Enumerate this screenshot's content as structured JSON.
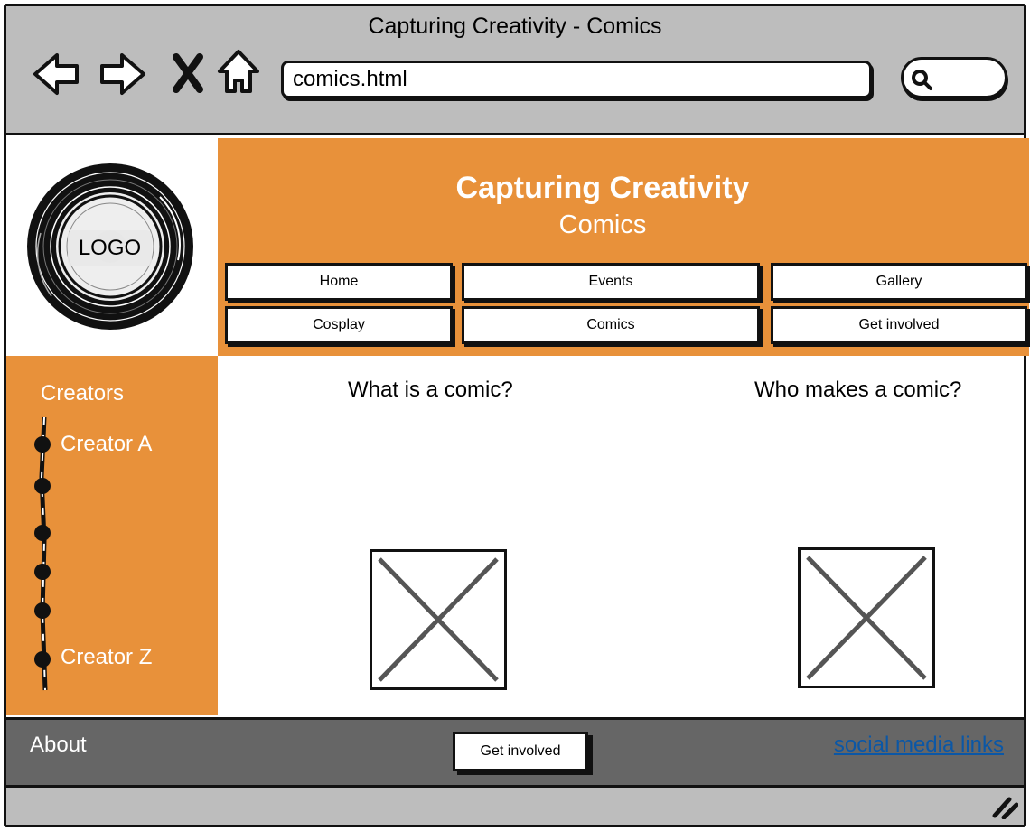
{
  "window": {
    "title": "Capturing Creativity - Comics"
  },
  "toolbar": {
    "back_icon": "back-arrow-icon",
    "forward_icon": "forward-arrow-icon",
    "stop_icon": "close-icon",
    "home_icon": "home-icon",
    "url": "comics.html",
    "search_icon": "search-icon"
  },
  "logo": {
    "label": "LOGO"
  },
  "header": {
    "title": "Capturing Creativity",
    "subtitle": "Comics"
  },
  "nav": {
    "items": [
      {
        "label": "Home"
      },
      {
        "label": "Events"
      },
      {
        "label": "Gallery"
      },
      {
        "label": "Cosplay"
      },
      {
        "label": "Comics"
      },
      {
        "label": "Get involved"
      }
    ]
  },
  "sidebar": {
    "title": "Creators",
    "first_creator": "Creator A",
    "last_creator": "Creator Z"
  },
  "main": {
    "left_heading": "What is a comic?",
    "right_heading": "Who makes a comic?"
  },
  "footer": {
    "about": "About",
    "button": "Get involved",
    "social": "social media links"
  },
  "colors": {
    "accent": "#e8913a",
    "chrome": "#bdbdbd",
    "footer": "#666666",
    "link": "#0b57a6"
  }
}
